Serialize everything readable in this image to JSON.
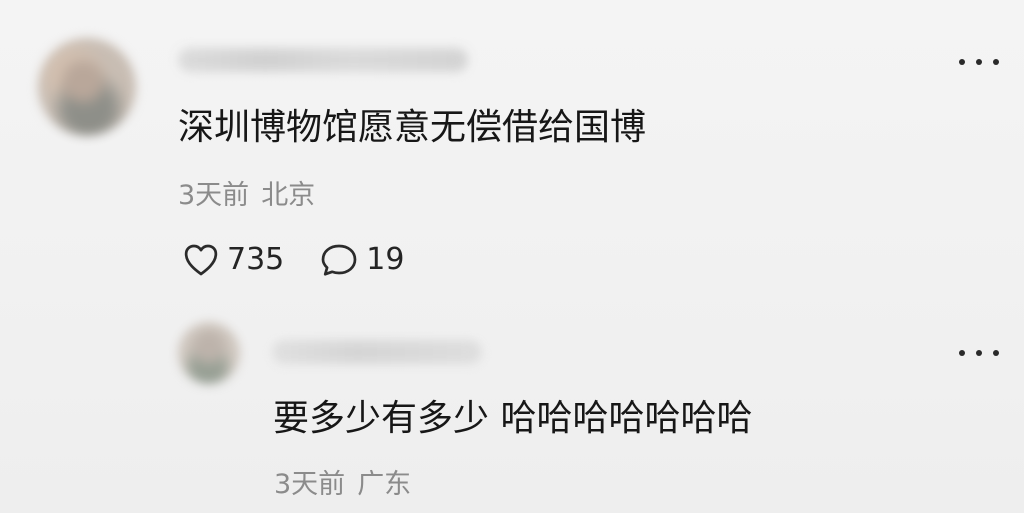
{
  "comment": {
    "text": "深圳博物馆愿意无偿借给国博",
    "time": "3天前",
    "location": "北京",
    "likes": "735",
    "replies": "19"
  },
  "reply": {
    "text": "要多少有多少 哈哈哈哈哈哈哈",
    "time": "3天前",
    "location": "广东"
  },
  "icons": {
    "like": "heart-icon",
    "comment": "comment-bubble-icon",
    "more": "more-options-icon"
  },
  "colors": {
    "background": "#f2f2f2",
    "text": "#171717",
    "meta": "#8b8b8b"
  }
}
